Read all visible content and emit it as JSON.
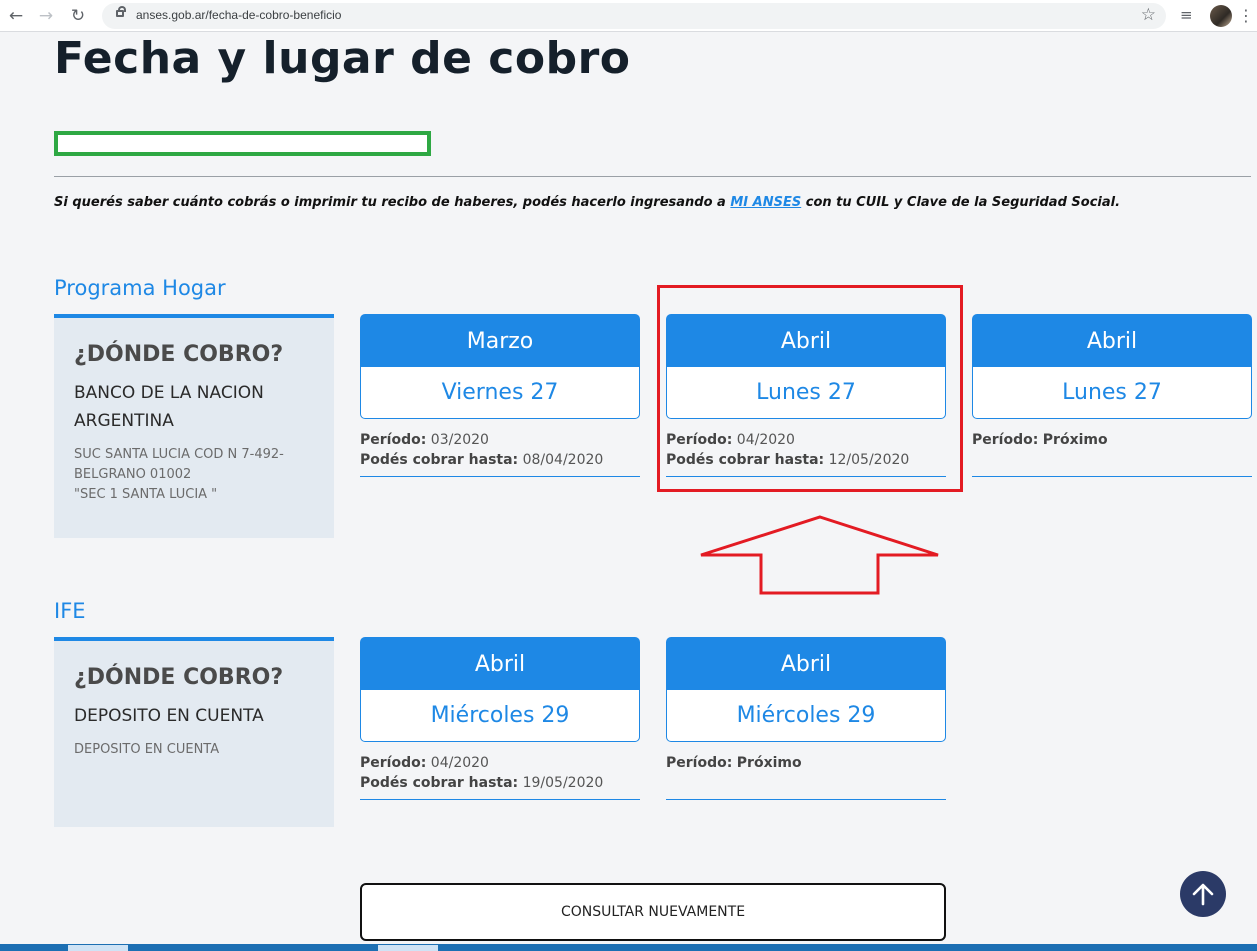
{
  "browser": {
    "url": "anses.gob.ar/fecha-de-cobro-beneficio",
    "back_icon": "←",
    "forward_icon": "→",
    "reload_icon": "↻",
    "star_icon": "☆",
    "queue_icon": "≡",
    "menu_icon": "⋮"
  },
  "page": {
    "title": "Fecha y lugar de cobro",
    "info_text_before": "Si querés saber cuánto cobrás o imprimir tu recibo de haberes, podés hacerlo ingresando a ",
    "info_link": "MI ANSES",
    "info_text_after": " con tu CUIL y Clave de la Seguridad Social."
  },
  "sections": [
    {
      "title": "Programa Hogar",
      "where_question": "¿DÓNDE COBRO?",
      "where_bank": "BANCO DE LA NACION ARGENTINA",
      "where_detail_lines": [
        "SUC SANTA LUCIA COD N 7-492-",
        "BELGRANO 01002",
        "\"SEC 1 SANTA LUCIA \""
      ],
      "cards": [
        {
          "month": "Marzo",
          "day": "Viernes 27",
          "periodo_label": "Período:",
          "periodo": "03/2020",
          "hasta_label": "Podés cobrar hasta:",
          "hasta": "08/04/2020"
        },
        {
          "month": "Abril",
          "day": "Lunes 27",
          "periodo_label": "Período:",
          "periodo": "04/2020",
          "hasta_label": "Podés cobrar hasta:",
          "hasta": "12/05/2020"
        },
        {
          "month": "Abril",
          "day": "Lunes 27",
          "periodo_label": "Período:",
          "periodo": "Próximo"
        }
      ]
    },
    {
      "title": "IFE",
      "where_question": "¿DÓNDE COBRO?",
      "where_bank": "DEPOSITO EN CUENTA",
      "where_detail_lines": [
        "DEPOSITO EN CUENTA"
      ],
      "cards": [
        {
          "month": "Abril",
          "day": "Miércoles 29",
          "periodo_label": "Período:",
          "periodo": "04/2020",
          "hasta_label": "Podés cobrar hasta:",
          "hasta": "19/05/2020"
        },
        {
          "month": "Abril",
          "day": "Miércoles 29",
          "periodo_label": "Período:",
          "periodo": "Próximo"
        }
      ]
    }
  ],
  "actions": {
    "consult_again": "CONSULTAR NUEVAMENTE"
  },
  "colors": {
    "accent": "#1e88e5",
    "highlight_red": "#e31b23",
    "highlight_green": "#2ea843",
    "back_to_top": "#2b3a67"
  }
}
